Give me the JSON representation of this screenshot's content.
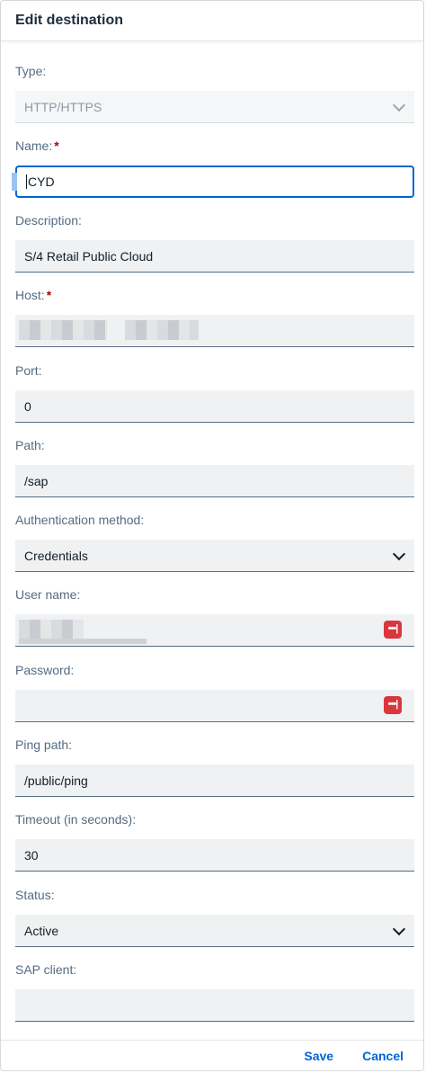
{
  "dialog": {
    "title": "Edit destination"
  },
  "fields": {
    "type": {
      "label": "Type:",
      "value": "HTTP/HTTPS"
    },
    "name": {
      "label": "Name:",
      "required": "*",
      "value": "CYD"
    },
    "description": {
      "label": "Description:",
      "value": "S/4 Retail Public Cloud"
    },
    "host": {
      "label": "Host:",
      "required": "*"
    },
    "port": {
      "label": "Port:",
      "value": "0"
    },
    "path": {
      "label": "Path:",
      "value": "/sap"
    },
    "auth": {
      "label": "Authentication method:",
      "value": "Credentials"
    },
    "username": {
      "label": "User name:",
      "icon": "password-manager-icon"
    },
    "password": {
      "label": "Password:",
      "icon": "password-manager-icon",
      "icon_glyph": "•••|"
    },
    "ping": {
      "label": "Ping path:",
      "value": "/public/ping"
    },
    "timeout": {
      "label": "Timeout (in seconds):",
      "value": "30"
    },
    "status": {
      "label": "Status:",
      "value": "Active"
    },
    "client": {
      "label": "SAP client:",
      "value": ""
    }
  },
  "footer": {
    "save_label": "Save",
    "cancel_label": "Cancel"
  },
  "colors": {
    "accent": "#0064d9",
    "required": "#aa0808",
    "password_icon": "#d9363e"
  }
}
